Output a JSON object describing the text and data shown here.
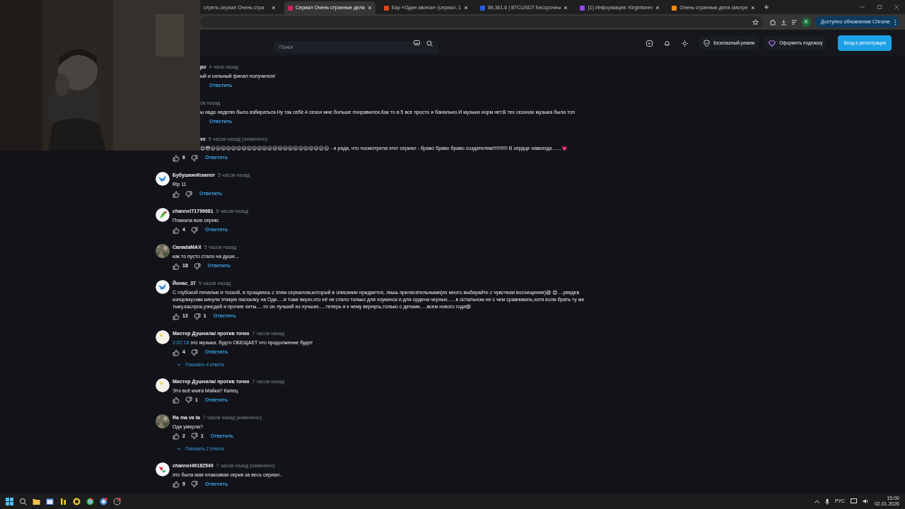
{
  "browser": {
    "tabs": [
      {
        "title": "отреть сериал Очень стра",
        "selected": false
      },
      {
        "title": "Сериал Очень странные дела",
        "selected": true,
        "color": "#c8265a"
      },
      {
        "title": "Бар «Один звонок» (сериал, 1",
        "selected": false,
        "color": "#d9481c"
      },
      {
        "title": "89,361.6 | BTCUSDT Бессрочны",
        "selected": false,
        "color": "#2a5bd7"
      },
      {
        "title": "(1) Информация: Kirgintseev",
        "selected": false,
        "color": "#9146ff"
      },
      {
        "title": "Очень странные дела смотре",
        "selected": false,
        "color": "#f08a12"
      }
    ],
    "profile_initial": "К",
    "update_label": "Доступно обновление Chrome"
  },
  "site_header": {
    "search": {
      "placeholder": "Поиск"
    },
    "actions": [
      {
        "kind": "shield",
        "label": "Безопасный режим"
      },
      {
        "kind": "diamond",
        "label": "Оформить подписку"
      }
    ],
    "login_button": "Вход и регистрация"
  },
  "comments": [
    {
      "author": "ро",
      "time": "4 часа назад",
      "text": "ый и сильный финал получился!",
      "clipped": true,
      "votes_shown": false,
      "reply": "Ответить"
    },
    {
      "time": "ов назад",
      "text": "ы надо неделю было взбираться.Ну так себе.4 сезон мне больше понравился.Как то в 5 все просто и банально.И музыки норм нет.В тех сезонах музыка была топ",
      "clipped": true,
      "votes_shown": false,
      "reply": "Ответить"
    },
    {
      "author": "ve",
      "time": "5 часов назад (изменено)",
      "text": "😍😳😖😖😖😖😖😖😖😖😖😖😖😖😖😖😖😖😖😖😖😖😖😖😖 - я рада, что посмотрела этот сериал - браво браво браво создателям!!!!!!!!!!! В сердце навсегда.......💗",
      "clipped": true,
      "votes_shown": true,
      "likes": "6",
      "reply": "Ответить"
    },
    {
      "avatar": {
        "kind": "bird"
      },
      "author": "БубушкинКомпот",
      "time": "5 часов назад",
      "text": "Rip 11",
      "clipped": false,
      "votes_shown": true,
      "reply": "Ответить"
    },
    {
      "avatar": {
        "kind": "parrot"
      },
      "author": "channel71799681",
      "time": "5 часов назад",
      "text": "Плакала всю серию.",
      "clipped": false,
      "votes_shown": true,
      "likes": "4",
      "reply": "Ответить"
    },
    {
      "author": "CanadaMAX",
      "time": "5 часов назад",
      "text": "как то пусто стало на душе...",
      "clipped": false,
      "votes_shown": true,
      "likes": "18",
      "reply": "Ответить"
    },
    {
      "avatar": {
        "kind": "bird"
      },
      "author": "Йонас_37",
      "time": "5 часов назад",
      "text": "С глубокой печалью и тоской, я прощаюсь с этим сериалом,который в описании нуждается, лишь прилагательными(их много выбирайте с чувством восхищения)😄 😍....увидев концовку,нам кинули этакую пасхалку на Оди.....я тоже верю,что её не стало только для хоукинса и для ордена черных......в остальном не с чем сравнивать,хотя если брать ту же тьму,каслрок,уэнсдей и прочие хиты.....то он лучший из лучших.....теперь я к нему вернусь,только с детьми.....всем нового года😄",
      "clipped": false,
      "votes_shown": true,
      "likes": "12",
      "dislikes": "1",
      "reply": "Ответить"
    },
    {
      "avatar": {
        "kind": "lamp"
      },
      "author": "Мистер Душнила/ против точек",
      "time": "7 часов назад",
      "timecode": "2:02:18",
      "text": "это музыка. будто ОБЕЩАЕТ что продолжение будет",
      "clipped": false,
      "votes_shown": true,
      "likes": "4",
      "reply": "Ответить",
      "show_replies": "Показать 4 ответа"
    },
    {
      "avatar": {
        "kind": "lamp"
      },
      "author": "Мистер Душнила/ против точек",
      "time": "7 часов назад",
      "text": "Это всё книга Майка? Капец",
      "clipped": false,
      "votes_shown": true,
      "dislikes": "1",
      "reply": "Ответить"
    },
    {
      "author": "Ra ma va ta",
      "time": "7 часов назад (изменено)",
      "text": "Оди умерла?",
      "clipped": false,
      "votes_shown": true,
      "likes": "2",
      "dislikes": "1",
      "reply": "Ответить",
      "show_replies": "Показать 2 ответа"
    },
    {
      "avatar": {
        "kind": "flag"
      },
      "author": "channel49182549",
      "time": "7 часов назад (изменено)",
      "text": "это была мая плаксивая серия за весь сериал..",
      "clipped": false,
      "votes_shown": true,
      "likes": "5",
      "reply": "Ответить"
    }
  ],
  "taskbar": {
    "language": "РУС",
    "time": "15:00",
    "date": "02.01.2026"
  }
}
